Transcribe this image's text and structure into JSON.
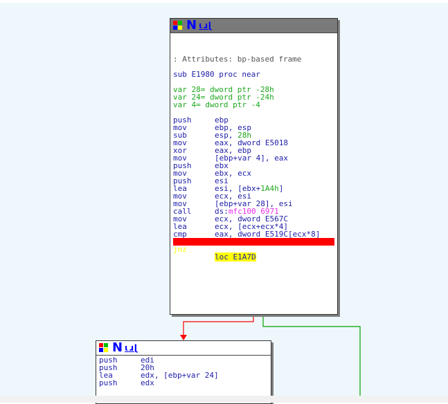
{
  "node1": {
    "header_glyph": "N",
    "header_mark": "ɩɹɭ",
    "comment": ": Attributes: bp-based frame",
    "proc": "sub E1980 proc near",
    "vars": [
      "var 28= dword ptr -28h",
      "var 24= dword ptr -24h",
      "var 4= dword ptr -4"
    ],
    "instructions": [
      {
        "mn": "push",
        "op": "ebp"
      },
      {
        "mn": "mov",
        "op": "ebp, esp"
      },
      {
        "mn": "sub",
        "op": "esp, ",
        "op2": "28h"
      },
      {
        "mn": "mov",
        "op": "eax, dword E5018"
      },
      {
        "mn": "xor",
        "op": "eax, ebp"
      },
      {
        "mn": "mov",
        "op": "[ebp+var 4], eax"
      },
      {
        "mn": "push",
        "op": "ebx"
      },
      {
        "mn": "mov",
        "op": "ebx, ecx"
      },
      {
        "mn": "push",
        "op": "esi"
      },
      {
        "mn": "lea",
        "op": "esi, [ebx+",
        "op2": "1A4h",
        "op3": "]"
      },
      {
        "mn": "mov",
        "op": "ecx, esi"
      },
      {
        "mn": "mov",
        "op": "[ebp+var 28], esi"
      },
      {
        "mn": "call",
        "op": "ds:",
        "op2": "mfc100 6971"
      },
      {
        "mn": "mov",
        "op": "ecx, dword E567C"
      },
      {
        "mn": "lea",
        "op": "ecx, [ecx+ecx*4]"
      },
      {
        "mn": "cmp",
        "op": "eax, dword E519C[ecx*8]"
      }
    ],
    "branch": {
      "mn": "jnz",
      "op": "loc E1A7D"
    }
  },
  "node2": {
    "header_glyph": "N",
    "header_mark": "ɩɹɭ",
    "instructions": [
      {
        "mn": "push",
        "op": "edi"
      },
      {
        "mn": "push",
        "op": "20h"
      },
      {
        "mn": "lea",
        "op": "edx, [ebp+var 24]"
      },
      {
        "mn": "push",
        "op": "edx"
      }
    ]
  },
  "colors": {
    "canvas": "#eef8fc",
    "true_edge": "#ff0000",
    "false_edge": "#00a000",
    "branch_highlight": "#ff0000",
    "cursor_highlight": "#ffff00"
  }
}
